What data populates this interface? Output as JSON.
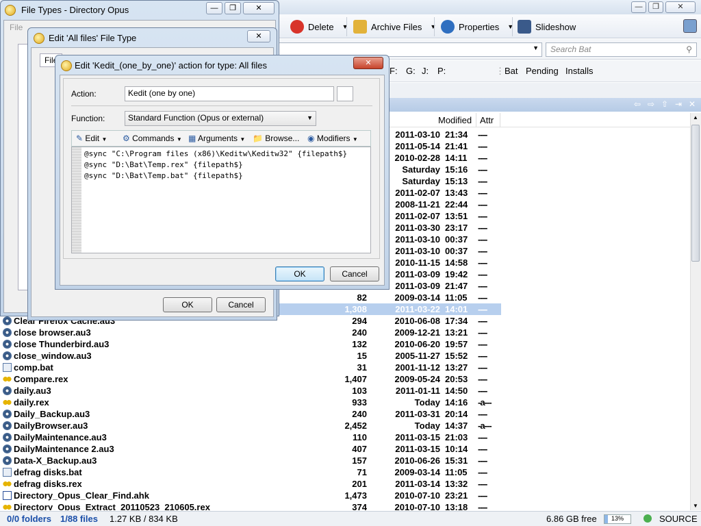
{
  "main_window": {
    "toolbar": {
      "delete": "Delete",
      "archive": "Archive Files",
      "properties": "Properties",
      "slideshow": "Slideshow"
    },
    "search_placeholder": "Search Bat",
    "drives": [
      "F:",
      "G:",
      "J:",
      "P:"
    ],
    "favorites": [
      "Bat",
      "Pending",
      "Installs"
    ],
    "columns": {
      "modified": "Modified",
      "attr": "Attr"
    },
    "files": [
      {
        "name": "",
        "size": "",
        "date": "2011-03-10",
        "time": "21:34",
        "attr": "----",
        "icon": "none"
      },
      {
        "name": "",
        "size": "",
        "date": "2011-05-14",
        "time": "21:41",
        "attr": "----",
        "icon": "none"
      },
      {
        "name": "",
        "size": "",
        "date": "2010-02-28",
        "time": "14:11",
        "attr": "----",
        "icon": "none"
      },
      {
        "name": "",
        "size": "",
        "date": "Saturday",
        "time": "15:16",
        "attr": "----",
        "icon": "none"
      },
      {
        "name": "",
        "size": "",
        "date": "Saturday",
        "time": "15:13",
        "attr": "----",
        "icon": "none"
      },
      {
        "name": "",
        "size": "",
        "date": "2011-02-07",
        "time": "13:43",
        "attr": "----",
        "icon": "none"
      },
      {
        "name": "",
        "size": "",
        "date": "2008-11-21",
        "time": "22:44",
        "attr": "----",
        "icon": "none"
      },
      {
        "name": "",
        "size": "",
        "date": "2011-02-07",
        "time": "13:51",
        "attr": "----",
        "icon": "none"
      },
      {
        "name": "",
        "size": "",
        "date": "2011-03-30",
        "time": "23:17",
        "attr": "----",
        "icon": "none"
      },
      {
        "name": "",
        "size": "",
        "date": "2011-03-10",
        "time": "00:37",
        "attr": "----",
        "icon": "none"
      },
      {
        "name": "",
        "size": "",
        "date": "2011-03-10",
        "time": "00:37",
        "attr": "----",
        "icon": "none"
      },
      {
        "name": "",
        "size": "",
        "date": "2010-11-15",
        "time": "14:58",
        "attr": "----",
        "icon": "none"
      },
      {
        "name": "",
        "size": "",
        "date": "2011-03-09",
        "time": "19:42",
        "attr": "----",
        "icon": "none"
      },
      {
        "name": "",
        "size": "",
        "date": "2011-03-09",
        "time": "21:47",
        "attr": "----",
        "icon": "none"
      },
      {
        "name": "",
        "size": "82",
        "date": "2009-03-14",
        "time": "11:05",
        "attr": "----",
        "icon": "none"
      },
      {
        "name": "",
        "size": "1,308",
        "date": "2011-03-22",
        "time": "14:01",
        "attr": "----",
        "icon": "none",
        "selected": true
      },
      {
        "name": "Clear Firefox Cache.au3",
        "size": "294",
        "date": "2010-06-08",
        "time": "17:34",
        "attr": "----",
        "icon": "au3"
      },
      {
        "name": "close browser.au3",
        "size": "240",
        "date": "2009-12-21",
        "time": "13:21",
        "attr": "----",
        "icon": "au3"
      },
      {
        "name": "close Thunderbird.au3",
        "size": "132",
        "date": "2010-06-20",
        "time": "19:57",
        "attr": "----",
        "icon": "au3"
      },
      {
        "name": "close_window.au3",
        "size": "15",
        "date": "2005-11-27",
        "time": "15:52",
        "attr": "----",
        "icon": "au3"
      },
      {
        "name": "comp.bat",
        "size": "31",
        "date": "2001-11-12",
        "time": "13:27",
        "attr": "----",
        "icon": "bat"
      },
      {
        "name": "Compare.rex",
        "size": "1,407",
        "date": "2009-05-24",
        "time": "20:53",
        "attr": "----",
        "icon": "rex"
      },
      {
        "name": "daily.au3",
        "size": "103",
        "date": "2011-01-11",
        "time": "14:50",
        "attr": "----",
        "icon": "au3"
      },
      {
        "name": "daily.rex",
        "size": "933",
        "date": "Today",
        "time": "14:16",
        "attr": "-a---",
        "icon": "rex"
      },
      {
        "name": "Daily_Backup.au3",
        "size": "240",
        "date": "2011-03-31",
        "time": "20:14",
        "attr": "----",
        "icon": "au3"
      },
      {
        "name": "DailyBrowser.au3",
        "size": "2,452",
        "date": "Today",
        "time": "14:37",
        "attr": "-a---",
        "icon": "au3"
      },
      {
        "name": "DailyMaintenance.au3",
        "size": "110",
        "date": "2011-03-15",
        "time": "21:03",
        "attr": "----",
        "icon": "au3"
      },
      {
        "name": "DailyMaintenance 2.au3",
        "size": "407",
        "date": "2011-03-15",
        "time": "10:14",
        "attr": "----",
        "icon": "au3"
      },
      {
        "name": "Data-X_Backup.au3",
        "size": "157",
        "date": "2010-06-26",
        "time": "15:31",
        "attr": "----",
        "icon": "au3"
      },
      {
        "name": "defrag disks.bat",
        "size": "71",
        "date": "2009-03-14",
        "time": "11:05",
        "attr": "----",
        "icon": "bat"
      },
      {
        "name": "defrag disks.rex",
        "size": "201",
        "date": "2011-03-14",
        "time": "13:32",
        "attr": "----",
        "icon": "rex"
      },
      {
        "name": "Directory_Opus_Clear_Find.ahk",
        "size": "1,473",
        "date": "2010-07-10",
        "time": "23:21",
        "attr": "----",
        "icon": "ahk"
      },
      {
        "name": "Directory_Opus_Extract_20110523_210605.rex",
        "size": "374",
        "date": "2010-07-10",
        "time": "13:18",
        "attr": "----",
        "icon": "rex"
      }
    ],
    "status": {
      "folders": "0/0 folders",
      "files": "1/88 files",
      "size": "1.27 KB / 834 KB",
      "free": "6.86 GB free",
      "percent": "13%",
      "percent_value": 0.13,
      "source": "SOURCE"
    }
  },
  "file_types_window": {
    "title": "File Types - Directory Opus",
    "menu_file": "File"
  },
  "edit_type_dialog": {
    "title": "Edit 'All files' File Type",
    "tab": "File",
    "ok": "OK",
    "cancel": "Cancel"
  },
  "action_dialog": {
    "title": "Edit 'Kedit_(one_by_one)' action for type: All files",
    "action_label": "Action:",
    "action_value": "Kedit (one by one)",
    "function_label": "Function:",
    "function_value": "Standard Function (Opus or external)",
    "toolbar": {
      "edit": "Edit",
      "commands": "Commands",
      "arguments": "Arguments",
      "browse": "Browse...",
      "modifiers": "Modifiers"
    },
    "code_lines": [
      "@sync \"C:\\Program files (x86)\\Keditw\\Keditw32\" {filepath$}",
      "@sync \"D:\\Bat\\Temp.rex\" {filepath$}",
      "@sync \"D:\\Bat\\Temp.bat\" {filepath$}"
    ],
    "ok": "OK",
    "cancel": "Cancel"
  },
  "colors": {
    "selection": "#b7cfee",
    "header_bar": "#c1d3e8",
    "close_red": "#c7432b"
  }
}
